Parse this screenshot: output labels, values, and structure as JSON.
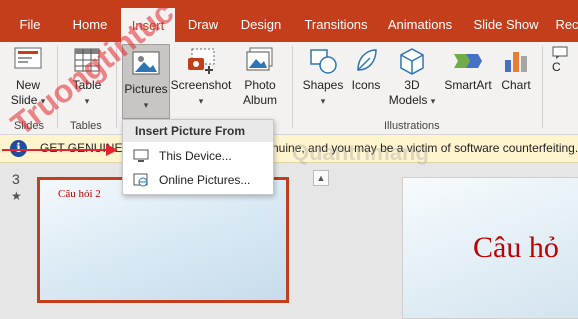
{
  "tabs": [
    {
      "label": "File",
      "active": false
    },
    {
      "label": "Home",
      "active": false
    },
    {
      "label": "Insert",
      "active": true
    },
    {
      "label": "Draw",
      "active": false
    },
    {
      "label": "Design",
      "active": false
    },
    {
      "label": "Transitions",
      "active": false
    },
    {
      "label": "Animations",
      "active": false
    },
    {
      "label": "Slide Show",
      "active": false
    },
    {
      "label": "Rec",
      "active": false
    }
  ],
  "ribbon": {
    "new_slide": "New",
    "new_slide_line2": "Slide",
    "table": "Table",
    "pictures": "Pictures",
    "screenshot": "Screenshot",
    "photo": "Photo",
    "photo_line2": "Album",
    "shapes": "Shapes",
    "icons": "Icons",
    "models": "3D",
    "models_line2": "Models",
    "smartart": "SmartArt",
    "chart": "Chart",
    "right_cut": "C",
    "groups": {
      "slides": "Slides",
      "tables": "Tables",
      "illustrations": "Illustrations"
    }
  },
  "infobar": {
    "icon": "i",
    "left_text": "GET GENUINE O",
    "right_text": "nuine, and you may be a victim of software counterfeiting."
  },
  "dropdown": {
    "header": "Insert Picture From",
    "items": [
      {
        "label": "This Device...",
        "icon": "device-icon"
      },
      {
        "label": "Online Pictures...",
        "icon": "online-pictures-icon"
      }
    ]
  },
  "slides": {
    "number": "3",
    "star": "★",
    "thumb_title": "Câu hỏi 2",
    "main_title": "Câu hỏ"
  },
  "watermark": {
    "text": "Truongtintuc",
    "text2": "Quantrimang"
  },
  "colors": {
    "accent": "#c43e1c",
    "title_red": "#c00000",
    "info_bg": "#fff4ce"
  }
}
